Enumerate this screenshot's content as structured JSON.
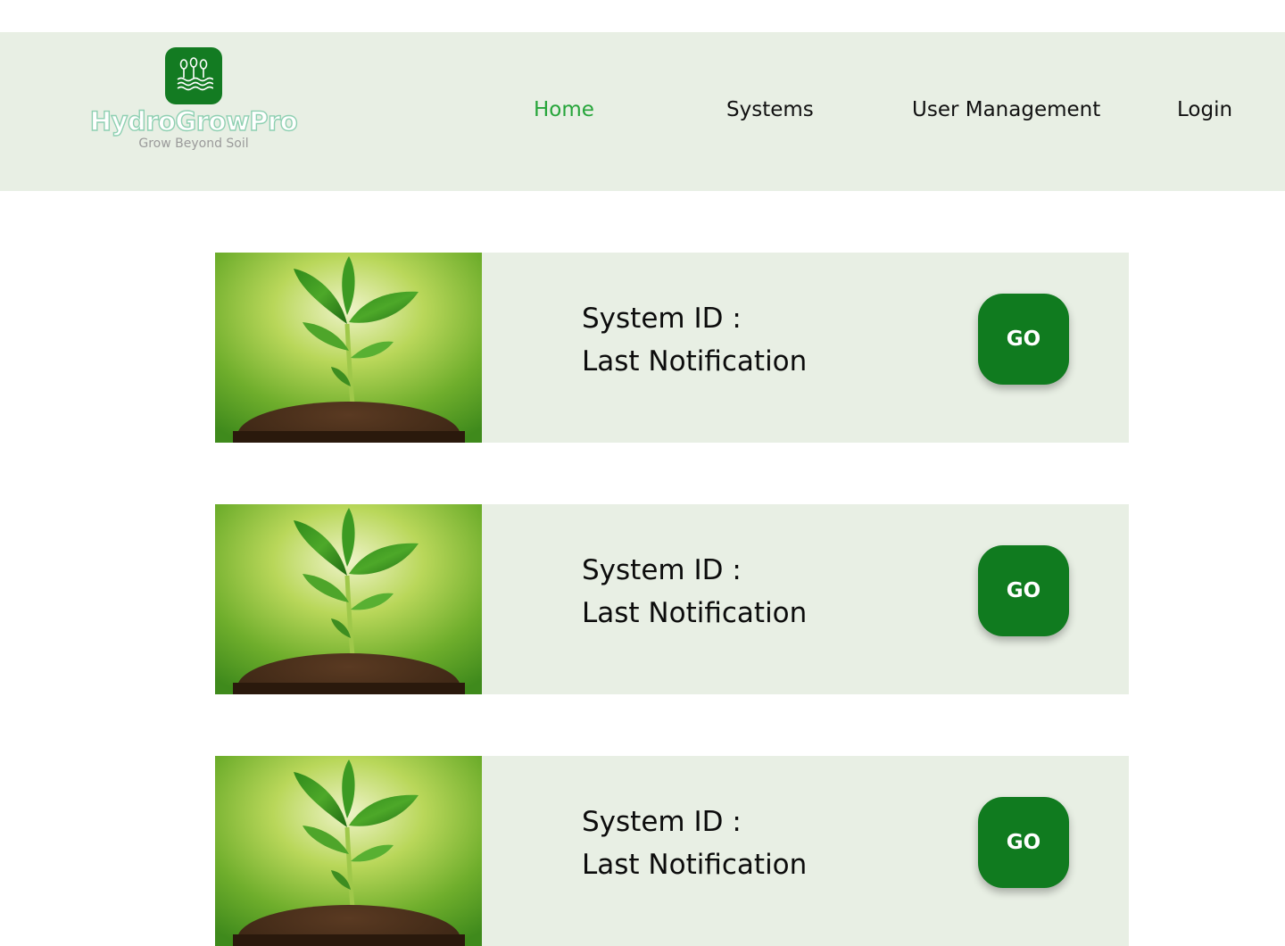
{
  "brand": {
    "name": "HydroGrowPro",
    "tagline": "Grow Beyond Soil",
    "icon": "plants-in-water-icon",
    "colors": {
      "tile": "#137b22",
      "wordmark": "#8fd0b2"
    }
  },
  "nav": {
    "items": [
      {
        "label": "Home",
        "active": true
      },
      {
        "label": "Systems",
        "active": false
      },
      {
        "label": "User Management",
        "active": false
      },
      {
        "label": "Login",
        "active": false
      }
    ],
    "active_color": "#26a53a"
  },
  "systems": [
    {
      "id_label": "System ID :",
      "notification_label": "Last Notification",
      "action": "GO",
      "image": "seedling-in-soil"
    },
    {
      "id_label": "System ID :",
      "notification_label": "Last Notification",
      "action": "GO",
      "image": "seedling-in-soil"
    },
    {
      "id_label": "System ID :",
      "notification_label": "Last Notification",
      "action": "GO",
      "image": "seedling-in-soil"
    }
  ],
  "colors": {
    "panel_background": "#e8efe4",
    "button": "#107b1f",
    "button_text": "#ffffff"
  }
}
